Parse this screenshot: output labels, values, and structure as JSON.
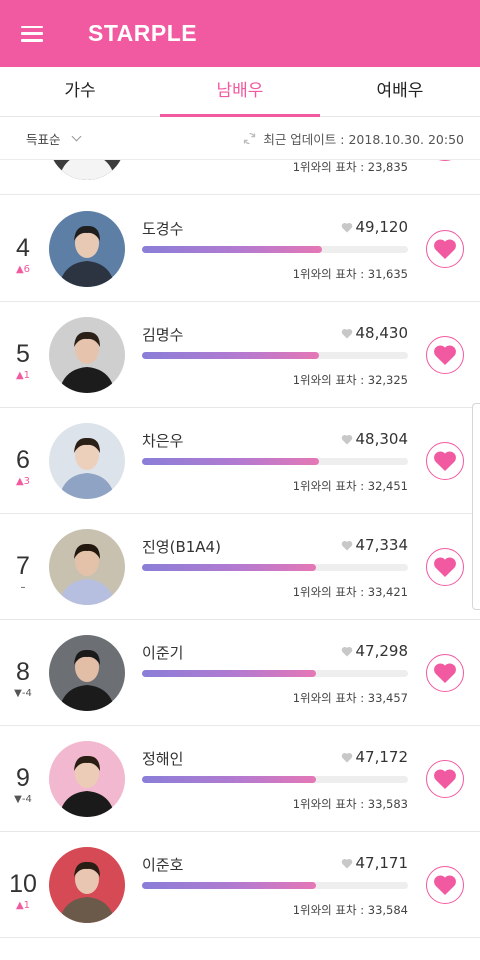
{
  "app": {
    "title": "STARPLE"
  },
  "tabs": [
    {
      "label": "가수",
      "active": false
    },
    {
      "label": "남배우",
      "active": true
    },
    {
      "label": "여배우",
      "active": false
    }
  ],
  "filter": {
    "sort_label": "득표순",
    "update_text": "최근 업데이트 : 2018.10.30. 20:50"
  },
  "colors": {
    "accent": "#f15aa0",
    "bar_start": "#8a7ed8",
    "bar_end": "#e577b6"
  },
  "gap_label": "1위와의 표차 : ",
  "ranking": [
    {
      "rank": "",
      "change": "",
      "name": "",
      "votes": "",
      "gap": "23,835",
      "bar_fraction": 0.69
    },
    {
      "rank": "4",
      "change": "6",
      "direction": "up",
      "name": "도경수",
      "votes": "49,120",
      "gap": "31,635",
      "bar_fraction": 0.675
    },
    {
      "rank": "5",
      "change": "1",
      "direction": "up",
      "name": "김명수",
      "votes": "48,430",
      "gap": "32,325",
      "bar_fraction": 0.665
    },
    {
      "rank": "6",
      "change": "3",
      "direction": "up",
      "name": "차은우",
      "votes": "48,304",
      "gap": "32,451",
      "bar_fraction": 0.665
    },
    {
      "rank": "7",
      "change": "",
      "direction": "none",
      "name": "진영(B1A4)",
      "votes": "47,334",
      "gap": "33,421",
      "bar_fraction": 0.655
    },
    {
      "rank": "8",
      "change": "-4",
      "direction": "down",
      "name": "이준기",
      "votes": "47,298",
      "gap": "33,457",
      "bar_fraction": 0.655
    },
    {
      "rank": "9",
      "change": "-4",
      "direction": "down",
      "name": "정해인",
      "votes": "47,172",
      "gap": "33,583",
      "bar_fraction": 0.655
    },
    {
      "rank": "10",
      "change": "1",
      "direction": "up",
      "name": "이준호",
      "votes": "47,171",
      "gap": "33,584",
      "bar_fraction": 0.655
    }
  ]
}
